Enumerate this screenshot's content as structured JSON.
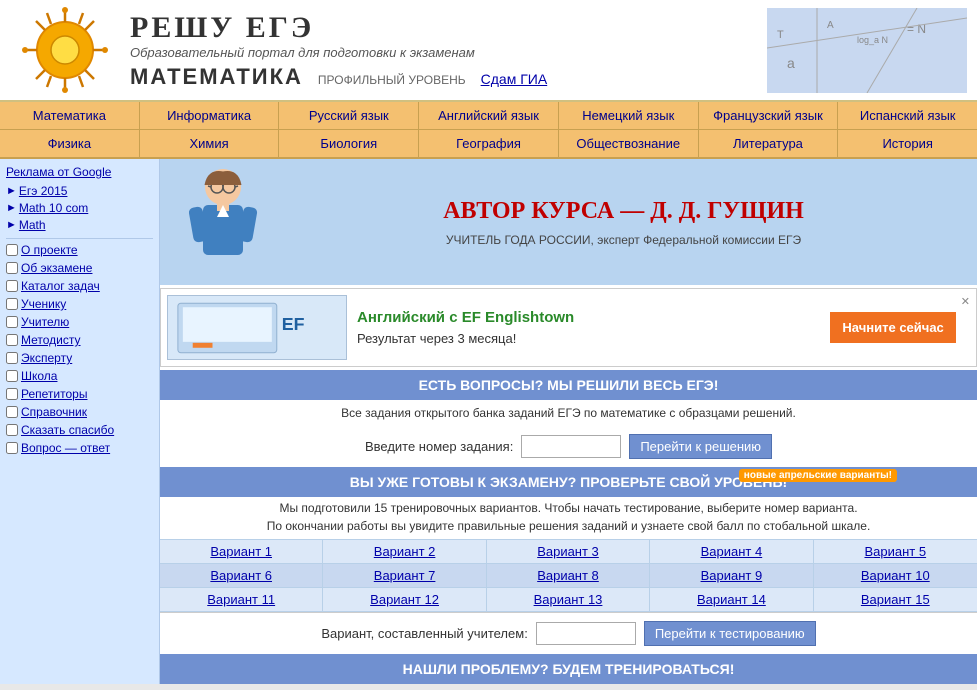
{
  "header": {
    "title": "РЕШУ ЕГЭ",
    "subtitle": "Образовательный портал для подготовки к экзаменам",
    "math_title": "МАТЕМАТИКА",
    "math_level": "ПРОФИЛЬНЫЙ УРОВЕНЬ",
    "gim_link": "Сдам ГИА"
  },
  "nav1": {
    "items": [
      "Математика",
      "Информатика",
      "Русский язык",
      "Английский язык",
      "Немецкий язык",
      "Французский язык",
      "Испанский язык"
    ]
  },
  "nav2": {
    "items": [
      "Физика",
      "Химия",
      "Биология",
      "География",
      "Обществознание",
      "Литература",
      "История"
    ]
  },
  "sidebar": {
    "ad_label": "Реклама от Google",
    "links": [
      {
        "label": "Егэ 2015"
      },
      {
        "label": "Math 10 com"
      },
      {
        "label": "Math"
      }
    ],
    "nav_items": [
      {
        "label": "О проекте"
      },
      {
        "label": "Об экзамене"
      },
      {
        "label": "Каталог задач"
      },
      {
        "label": "Ученику"
      },
      {
        "label": "Учителю"
      },
      {
        "label": "Методисту"
      },
      {
        "label": "Эксперту"
      },
      {
        "label": "Школа"
      },
      {
        "label": "Репетиторы"
      },
      {
        "label": "Справочник"
      },
      {
        "label": "Сказать спасибо"
      },
      {
        "label": "Вопрос — ответ"
      }
    ]
  },
  "banner": {
    "author_title": "АВТОР КУРСА — Д. Д. ГУЩИН",
    "author_subtitle": "УЧИТЕЛЬ ГОДА РОССИИ, эксперт Федеральной комиссии ЕГЭ"
  },
  "ad": {
    "title": "Английский с EF Englishtown",
    "subtitle": "Результат через 3 месяца!",
    "button": "Начните сейчас"
  },
  "section1": {
    "header": "ЕСТЬ ВОПРОСЫ? МЫ РЕШИЛИ ВЕСЬ ЕГЭ!",
    "subtext": "Все задания открытого банка заданий ЕГЭ по математике с образцами решений.",
    "input_label": "Введите номер задания:",
    "button_label": "Перейти к решению"
  },
  "section2": {
    "header": "ВЫ УЖЕ ГОТОВЫ К ЭКЗАМЕНУ? ПРОВЕРЬТЕ СВОЙ УРОВЕНЬ!",
    "new_badge": "новые апрельские варианты!",
    "subtext1": "Мы подготовили 15 тренировочных вариантов. Чтобы начать тестирование, выберите номер варианта.",
    "subtext2": "По окончании работы вы увидите правильные решения заданий и узнаете свой балл по стобальной шкале.",
    "variants_row1": [
      "Вариант 1",
      "Вариант 2",
      "Вариант 3",
      "Вариант 4",
      "Вариант 5"
    ],
    "variants_row2": [
      "Вариант 6",
      "Вариант 7",
      "Вариант 8",
      "Вариант 9",
      "Вариант 10"
    ],
    "variants_row3": [
      "Вариант 11",
      "Вариант 12",
      "Вариант 13",
      "Вариант 14",
      "Вариант 15"
    ],
    "teacher_label": "Вариант, составленный учителем:",
    "teacher_button": "Перейти к тестированию"
  },
  "section3": {
    "header": "НАШЛИ ПРОБЛЕМУ? БУДЕМ ТРЕНИРОВАТЬСЯ!"
  }
}
